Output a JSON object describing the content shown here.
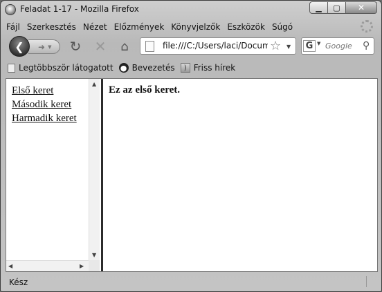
{
  "window": {
    "title": "Feladat 1-17 - Mozilla Firefox"
  },
  "menu": [
    "Fájl",
    "Szerkesztés",
    "Nézet",
    "Előzmények",
    "Könyvjelzők",
    "Eszközök",
    "Súgó"
  ],
  "navbar": {
    "url": "file:///C:/Users/laci/Documents/",
    "search_engine": "G",
    "search_placeholder": "Google"
  },
  "bookmarks": [
    {
      "label": "Legtöbbször látogatott",
      "icon": "page-icon"
    },
    {
      "label": "Bevezetés",
      "icon": "firefox-icon"
    },
    {
      "label": "Friss hírek",
      "icon": "rss-icon"
    }
  ],
  "frames": {
    "left_links": [
      "Első keret",
      "Második keret",
      "Harmadik keret"
    ],
    "right_heading": "Ez az első keret."
  },
  "status": {
    "text": "Kész"
  }
}
